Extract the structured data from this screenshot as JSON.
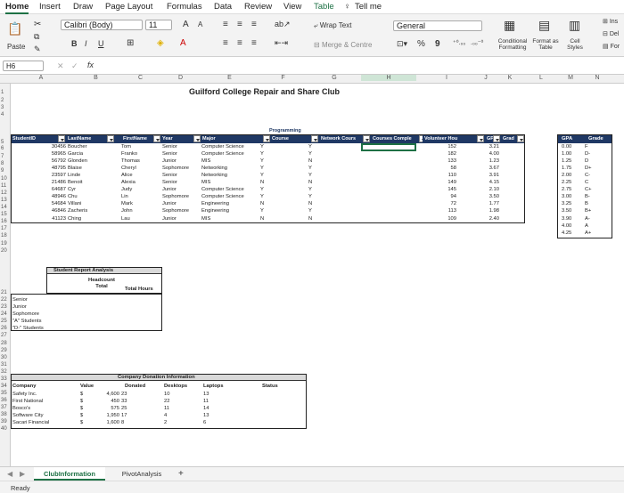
{
  "menu": [
    "Home",
    "Insert",
    "Draw",
    "Page Layout",
    "Formulas",
    "Data",
    "Review",
    "View",
    "Table",
    "Tell me"
  ],
  "ribbon": {
    "paste": "Paste",
    "font": "Calibri (Body)",
    "size": "11",
    "grow": "A",
    "shrink": "A",
    "bold": "B",
    "italic": "I",
    "underline": "U",
    "wrap": "Wrap Text",
    "merge": "Merge & Centre",
    "number_format": "General",
    "percent": "%",
    "comma": "9",
    "conditional": "Conditional Formatting",
    "format_table": "Format as Table",
    "cell_styles": "Cell Styles",
    "ins": "Ins",
    "del": "Del",
    "for": "For"
  },
  "formula_bar": {
    "cell_ref": "H6",
    "fx": "fx",
    "value": ""
  },
  "columns": [
    "A",
    "B",
    "C",
    "D",
    "E",
    "F",
    "G",
    "H",
    "I",
    "J",
    "K",
    "L",
    "M",
    "N"
  ],
  "rows": [
    "1",
    "2",
    "3",
    "4",
    "5",
    "6",
    "7",
    "8",
    "9",
    "10",
    "11",
    "12",
    "13",
    "14",
    "15",
    "16",
    "17",
    "18",
    "19",
    "20",
    "21",
    "22",
    "23",
    "24",
    "25",
    "26",
    "27",
    "28",
    "29",
    "30",
    "31",
    "32",
    "33",
    "34",
    "35",
    "36",
    "37",
    "38",
    "39",
    "40"
  ],
  "title": "Guilford College Repair and Share Club",
  "prog_label": "Programming",
  "headers": [
    "StudentID",
    "LastName",
    "FirstName",
    "Year",
    "Major",
    "Course",
    "Network Cours",
    "Courses Comple",
    "Volunteer Hou",
    "GP",
    "Grad"
  ],
  "students": [
    [
      "30456",
      "Boucher",
      "Tom",
      "Senior",
      "Computer Science",
      "Y",
      "Y",
      "",
      "152",
      "3.21"
    ],
    [
      "58965",
      "Garcia",
      "Franko",
      "Senior",
      "Computer Science",
      "Y",
      "Y",
      "",
      "182",
      "4.00"
    ],
    [
      "56792",
      "Glonden",
      "Thomas",
      "Junior",
      "MIS",
      "Y",
      "N",
      "",
      "133",
      "1.23"
    ],
    [
      "48795",
      "Blaise",
      "Cheryl",
      "Sophomore",
      "Networking",
      "Y",
      "Y",
      "",
      "58",
      "3.67"
    ],
    [
      "23597",
      "Linde",
      "Alice",
      "Senior",
      "Networking",
      "Y",
      "Y",
      "",
      "110",
      "3.91"
    ],
    [
      "21486",
      "Benoit",
      "Alexia",
      "Senior",
      "MIS",
      "N",
      "N",
      "",
      "149",
      "4.15"
    ],
    [
      "64687",
      "Cyr",
      "Judy",
      "Junior",
      "Computer Science",
      "Y",
      "Y",
      "",
      "145",
      "2.10"
    ],
    [
      "48946",
      "Chu",
      "Lin",
      "Sophomore",
      "Computer Science",
      "Y",
      "Y",
      "",
      "94",
      "3.50"
    ],
    [
      "54684",
      "Villani",
      "Mark",
      "Junior",
      "Engineering",
      "N",
      "N",
      "",
      "72",
      "1.77"
    ],
    [
      "46846",
      "Zacheris",
      "John",
      "Sophomore",
      "Engineering",
      "Y",
      "Y",
      "",
      "113",
      "1.98"
    ],
    [
      "41123",
      "Ching",
      "Lau",
      "Junior",
      "MIS",
      "N",
      "N",
      "",
      "109",
      "2.40"
    ]
  ],
  "gpa_table": {
    "headers": [
      "GPA",
      "Grade"
    ],
    "rows": [
      [
        "0.00",
        "F"
      ],
      [
        "1.00",
        "D-"
      ],
      [
        "1.25",
        "D"
      ],
      [
        "1.75",
        "D+"
      ],
      [
        "2.00",
        "C-"
      ],
      [
        "2.25",
        "C"
      ],
      [
        "2.75",
        "C+"
      ],
      [
        "3.00",
        "B-"
      ],
      [
        "3.25",
        "B"
      ],
      [
        "3.50",
        "B+"
      ],
      [
        "3.90",
        "A-"
      ],
      [
        "4.00",
        "A"
      ],
      [
        "4.25",
        "A+"
      ]
    ]
  },
  "report": {
    "title": "Student Report Analysis",
    "col1": "Headcount Total",
    "col2": "Total Hours",
    "rows": [
      "Senior",
      "Junior",
      "Sophomore",
      "\"A\" Students",
      "\"D-\" Students"
    ]
  },
  "donation": {
    "title": "Company Donation Information",
    "headers": [
      "Company",
      "Value",
      "Donated",
      "Desktops",
      "Laptops",
      "Status"
    ],
    "rows": [
      [
        "Safety Inc.",
        "$",
        "4,600",
        "23",
        "10",
        "13"
      ],
      [
        "First National",
        "$",
        "450",
        "33",
        "22",
        "11"
      ],
      [
        "Bosco's",
        "$",
        "575",
        "25",
        "11",
        "14"
      ],
      [
        "Software City",
        "$",
        "1,950",
        "17",
        "4",
        "13"
      ],
      [
        "Sacari Financial",
        "$",
        "1,600",
        "8",
        "2",
        "6"
      ]
    ]
  },
  "tabs": [
    "ClubInformation",
    "PivotAnalysis",
    "+"
  ],
  "status": "Ready",
  "colors": {
    "header": "#1f3864",
    "accent": "#1e7145"
  }
}
